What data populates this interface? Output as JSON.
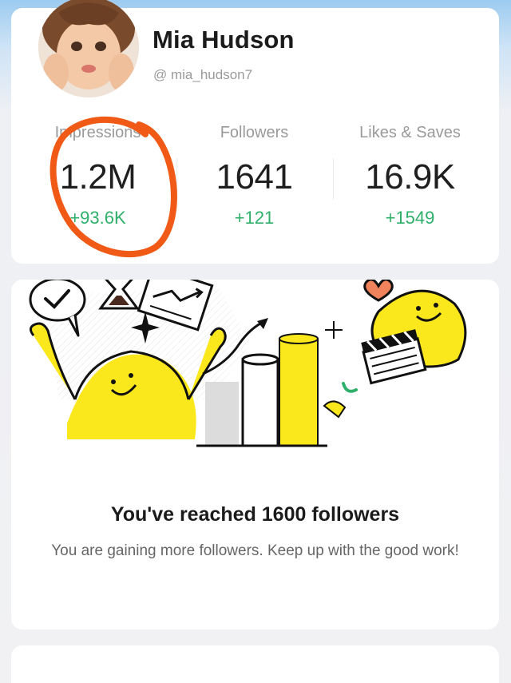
{
  "profile": {
    "name": "Mia Hudson",
    "handle": "@ mia_hudson7"
  },
  "stats": [
    {
      "label": "Impressions",
      "value": "1.2M",
      "delta": "+93.6K"
    },
    {
      "label": "Followers",
      "value": "1641",
      "delta": "+121"
    },
    {
      "label": "Likes & Saves",
      "value": "16.9K",
      "delta": "+1549"
    }
  ],
  "milestone": {
    "title": "You've reached 1600 followers",
    "description": "You are gaining more followers. Keep up with the good work!"
  },
  "colors": {
    "positive": "#2eaf6a",
    "annotation": "#f05a16",
    "illustration_yellow": "#fbe81c"
  },
  "icons": [
    "avatar-photo",
    "checkmark-bubble-icon",
    "hourglass-icon",
    "chart-board-icon",
    "star-sparkle-icon",
    "heart-icon",
    "clapperboard-icon",
    "trend-arrow-icon"
  ]
}
